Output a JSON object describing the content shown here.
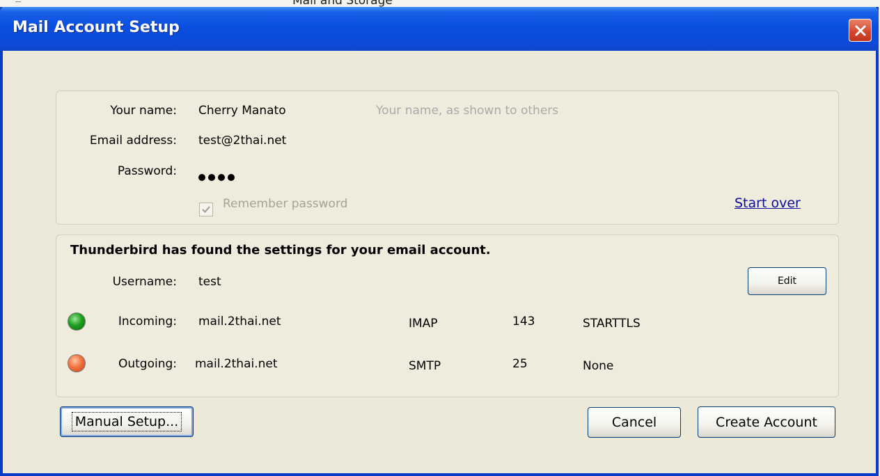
{
  "background": {
    "ghost_text": "Mail and Storage"
  },
  "window": {
    "title": "Mail Account Setup"
  },
  "account": {
    "name_label": "Your name:",
    "name_value": "Cherry Manato",
    "name_hint": "Your name, as shown to others",
    "email_label": "Email address:",
    "email_value": "test@2thai.net",
    "password_label": "Password:",
    "password_length": 4,
    "remember_label": "Remember password",
    "remember_checked": true,
    "start_over": "Start over"
  },
  "settings": {
    "heading": "Thunderbird has found the settings for your email account.",
    "username_label": "Username:",
    "username_value": "test",
    "edit_button": "Edit",
    "incoming": {
      "label": "Incoming:",
      "server": "mail.2thai.net",
      "protocol": "IMAP",
      "port": "143",
      "security": "STARTTLS",
      "status_color": "#1fa01f"
    },
    "outgoing": {
      "label": "Outgoing:",
      "server": "mail.2thai.net",
      "protocol": "SMTP",
      "port": "25",
      "security": "None",
      "status_color": "#f27440"
    }
  },
  "buttons": {
    "manual_setup": "Manual Setup...",
    "cancel": "Cancel",
    "create_account": "Create Account"
  },
  "colors": {
    "titlebar": "#0a4ee0",
    "dialog_bg": "#ece9d8",
    "link": "#0a0a9e",
    "close_button": "#d2442a"
  }
}
